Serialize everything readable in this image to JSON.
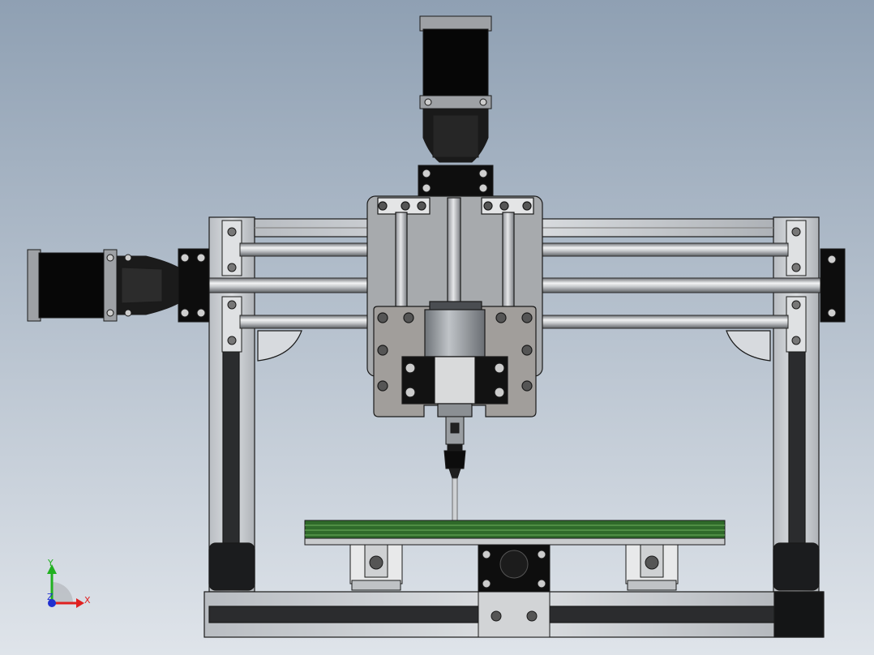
{
  "viewport": {
    "background_top": "#8fa0b3",
    "background_bottom": "#dfe4ea",
    "part_edge_color": "#1a1a1a",
    "metal_color": "#a7aaad",
    "aluminum_color": "#c9ccd0",
    "motor_body_color": "#070707",
    "pcb_green": "#2f6a2a"
  },
  "triad": {
    "x_label": "X",
    "y_label": "Y",
    "z_label": "Z",
    "x_color": "#e02020",
    "y_color": "#20b020",
    "z_color": "#2030d0"
  }
}
